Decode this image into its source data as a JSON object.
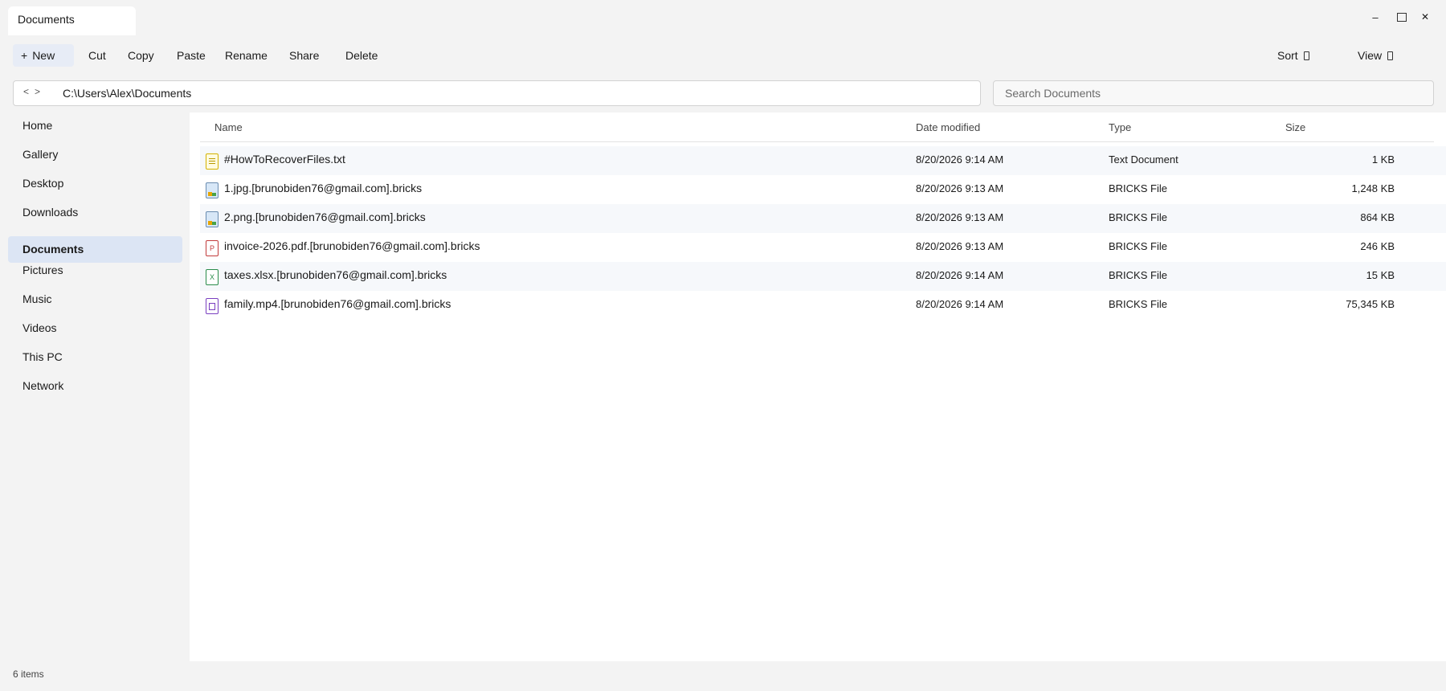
{
  "window": {
    "tab_title": "Documents",
    "controls": {
      "minimize": "–",
      "close": "✕"
    }
  },
  "toolbar": {
    "new_label": "New",
    "new_icon": "+",
    "cut_label": "Cut",
    "copy_label": "Copy",
    "paste_label": "Paste",
    "rename_label": "Rename",
    "share_label": "Share",
    "delete_label": "Delete",
    "sort_label": "Sort",
    "view_label": "View"
  },
  "address": {
    "back_icon": "<",
    "forward_icon": ">",
    "path": "C:\\Users\\Alex\\Documents"
  },
  "search": {
    "placeholder": "Search Documents"
  },
  "sidebar": {
    "items": [
      {
        "label": "Home"
      },
      {
        "label": "Gallery"
      },
      {
        "label": "Desktop"
      },
      {
        "label": "Downloads"
      },
      {
        "label": "Documents",
        "active": true
      },
      {
        "label": "Pictures"
      },
      {
        "label": "Music"
      },
      {
        "label": "Videos"
      },
      {
        "label": "This PC"
      },
      {
        "label": "Network"
      }
    ]
  },
  "columns": {
    "name": "Name",
    "date": "Date modified",
    "type": "Type",
    "size": "Size"
  },
  "files": [
    {
      "name": "#HowToRecoverFiles.txt",
      "date": "8/20/2026 9:14 AM",
      "type": "Text Document",
      "size": "1 KB",
      "icon": "text-file-icon"
    },
    {
      "name": "1.jpg.[brunobiden76@gmail.com].bricks",
      "date": "8/20/2026 9:13 AM",
      "type": "BRICKS File",
      "size": "1,248 KB",
      "icon": "image-file-icon"
    },
    {
      "name": "2.png.[brunobiden76@gmail.com].bricks",
      "date": "8/20/2026 9:13 AM",
      "type": "BRICKS File",
      "size": "864 KB",
      "icon": "image-file-icon"
    },
    {
      "name": "invoice-2026.pdf.[brunobiden76@gmail.com].bricks",
      "date": "8/20/2026 9:13 AM",
      "type": "BRICKS File",
      "size": "246 KB",
      "icon": "pdf-file-icon",
      "glyph": "P"
    },
    {
      "name": "taxes.xlsx.[brunobiden76@gmail.com].bricks",
      "date": "8/20/2026 9:14 AM",
      "type": "BRICKS File",
      "size": "15 KB",
      "icon": "spreadsheet-file-icon",
      "glyph": "X"
    },
    {
      "name": "family.mp4.[brunobiden76@gmail.com].bricks",
      "date": "8/20/2026 9:14 AM",
      "type": "BRICKS File",
      "size": "75,345 KB",
      "icon": "video-file-icon"
    }
  ],
  "status": {
    "item_count": "6 items"
  },
  "colors": {
    "accent": "#dce5f4",
    "new_button": "#e7ecf6",
    "row_alt": "#f6f8fb"
  }
}
